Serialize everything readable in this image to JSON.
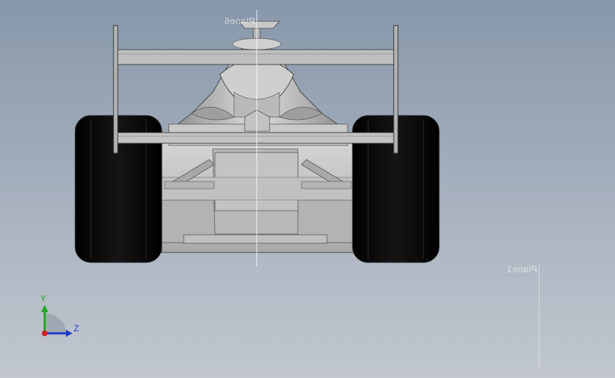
{
  "viewport": {
    "background_top": "#8797aa",
    "background_bottom": "#c2c7cf"
  },
  "planes": {
    "top_label": "Plane6",
    "right_label": "Plane1"
  },
  "triad": {
    "y_label": "Y",
    "z_label": "Z",
    "y_color": "#1fa51f",
    "z_color": "#1d39c8",
    "origin_color": "#d01f1f"
  },
  "model": {
    "icon": "race-car-icon",
    "tire_color": "#0a0a0a",
    "body_color": "#c6c6c6",
    "wing_color": "#bdbdbd"
  }
}
